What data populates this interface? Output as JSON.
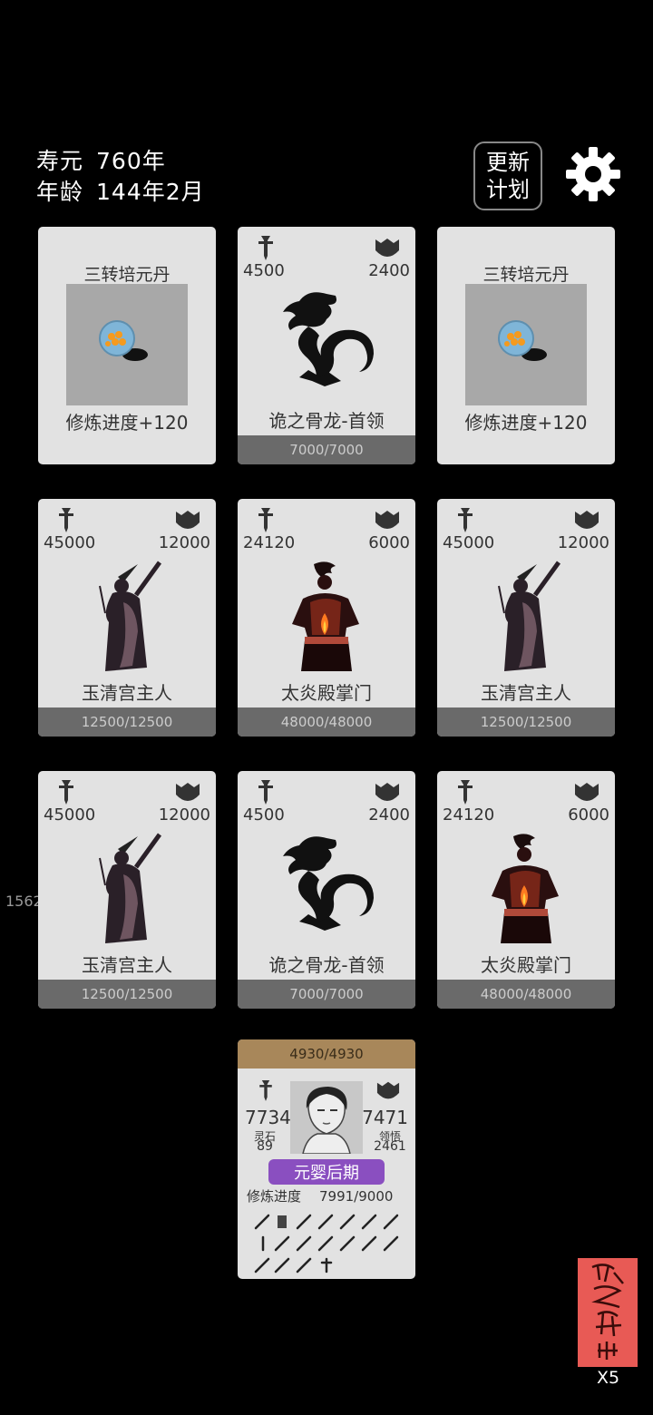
{
  "status": {
    "lifespan_label": "寿元",
    "lifespan_value": "760年",
    "age_label": "年龄",
    "age_value": "144年2月"
  },
  "update_plan_button": "更新\n计划",
  "icons": {
    "settings": "gear-icon",
    "attack": "sword-icon",
    "defense": "shield-icon",
    "seal": "seal-stamp"
  },
  "cards": [
    {
      "type": "item",
      "title": "三转培元丹",
      "desc": "修炼进度+120"
    },
    {
      "type": "enemy",
      "atk": "4500",
      "def": "2400",
      "name": "诡之骨龙-首领",
      "hp": "7000/7000",
      "art": "dragon"
    },
    {
      "type": "item",
      "title": "三转培元丹",
      "desc": "修炼进度+120"
    },
    {
      "type": "enemy",
      "atk": "45000",
      "def": "12000",
      "name": "玉清宫主人",
      "hp": "12500/12500",
      "art": "sage"
    },
    {
      "type": "enemy",
      "atk": "24120",
      "def": "6000",
      "name": "太炎殿掌门",
      "hp": "48000/48000",
      "art": "flame"
    },
    {
      "type": "enemy",
      "atk": "45000",
      "def": "12000",
      "name": "玉清宫主人",
      "hp": "12500/12500",
      "art": "sage"
    },
    {
      "type": "enemy",
      "atk": "45000",
      "def": "12000",
      "name": "玉清宫主人",
      "hp": "12500/12500",
      "art": "sage"
    },
    {
      "type": "enemy",
      "atk": "4500",
      "def": "2400",
      "name": "诡之骨龙-首领",
      "hp": "7000/7000",
      "art": "dragon"
    },
    {
      "type": "enemy",
      "atk": "24120",
      "def": "6000",
      "name": "太炎殿掌门",
      "hp": "48000/48000",
      "art": "flame"
    }
  ],
  "side_number": "1562",
  "player": {
    "hp": "4930/4930",
    "atk": "7734",
    "def": "7471",
    "spirit_stone_label": "灵石",
    "spirit_stone_value": "89",
    "insight_label": "领悟",
    "insight_value": "2461",
    "realm": "元婴后期",
    "progress_label": "修炼进度",
    "progress_value": "7991/9000"
  },
  "seal_multiplier": "X5"
}
